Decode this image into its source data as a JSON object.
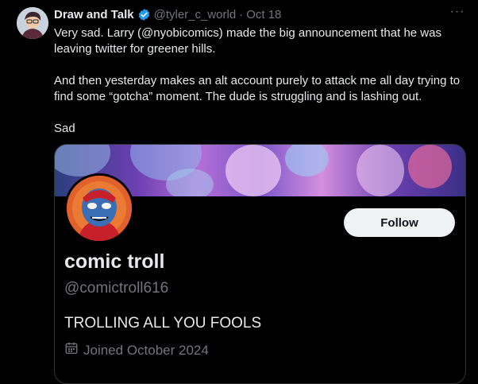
{
  "tweet": {
    "display_name": "Draw and Talk",
    "handle": "@tyler_c_world",
    "separator": "·",
    "date": "Oct 18",
    "more_label": "···",
    "paragraphs": [
      "Very sad. Larry (@nyobicomics) made the big announcement that he was leaving twitter for greener hills.",
      "And then yesterday makes an alt account purely to attack me all day trying to find some “gotcha” moment. The dude is struggling and is lashing out.",
      "Sad"
    ]
  },
  "profile_card": {
    "name": "comic troll",
    "handle": "@comictroll616",
    "bio": "TROLLING ALL YOU FOOLS",
    "joined": "Joined October 2024",
    "follow_label": "Follow"
  },
  "icons": {
    "verified": "verified-badge-icon",
    "more": "more-icon",
    "calendar": "calendar-icon"
  },
  "colors": {
    "background": "#000000",
    "text": "#e7e9ea",
    "muted": "#71767b",
    "verified": "#1d9bf0",
    "button_bg": "#eff3f4",
    "button_text": "#0f1419",
    "border": "#2f3336"
  }
}
